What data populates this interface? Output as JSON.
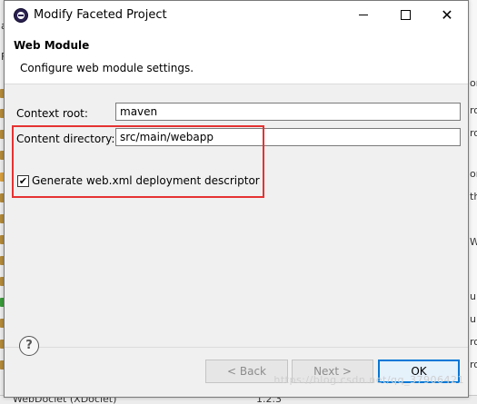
{
  "window": {
    "title": "Modify Faceted Project",
    "minimize_label": "",
    "maximize_label": "",
    "close_label": "✕"
  },
  "header": {
    "title": "Web Module",
    "description": "Configure web module settings."
  },
  "form": {
    "context_root_label": "Context root:",
    "context_root_value": "maven",
    "content_dir_label": "Content directory:",
    "content_dir_value": "src/main/webapp",
    "generate_label": "Generate web.xml deployment descriptor",
    "generate_checked": true,
    "check_glyph": "✔"
  },
  "footer": {
    "help_label": "?",
    "back_label": "< Back",
    "next_label": "Next >",
    "ok_label": "OK"
  },
  "background": {
    "left_fragments": [
      "a",
      "F"
    ],
    "right_fragments": [
      "or",
      "ro",
      "ro",
      "or",
      "th",
      "W",
      "ul",
      "ul",
      "ro",
      "ro"
    ],
    "bottom_text": "WebDoclet (XDoclet)",
    "bottom_version": "1.2.3"
  },
  "watermark": "https://blog.csdn.net/qq_37906421",
  "colors": {
    "highlight": "#e53232",
    "default_button_border": "#0078d7"
  }
}
